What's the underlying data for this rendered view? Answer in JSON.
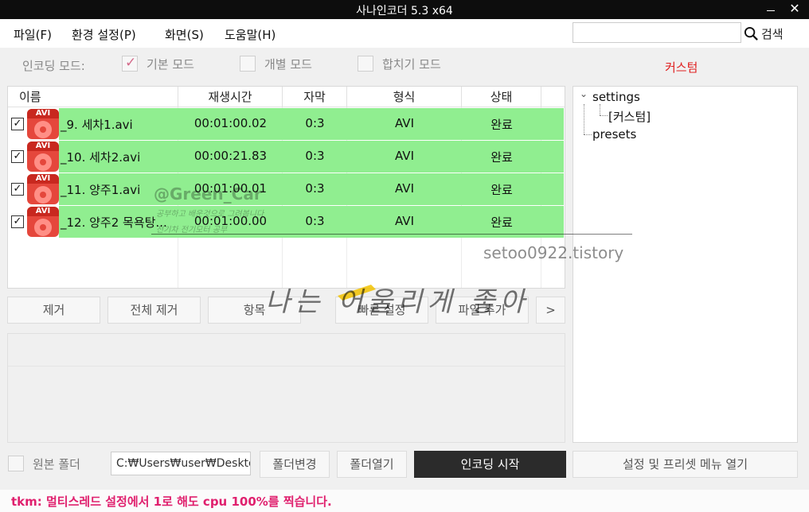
{
  "window": {
    "title": "사나인코더  5.3 x64"
  },
  "menu": {
    "items": [
      "파일(F)",
      "환경 설정(P)",
      "화면(S)",
      "도움말(H)"
    ],
    "search_label": "검색"
  },
  "mode": {
    "label": "인코딩 모드:",
    "basic": "기본 모드",
    "individual": "개별 모드",
    "merge": "합치기 모드",
    "basic_checked": true
  },
  "custom_title": "커스텀",
  "table": {
    "headers": [
      "이름",
      "재생시간",
      "자막",
      "형식",
      "상태"
    ],
    "rows": [
      {
        "name": "_9. 세차1.avi",
        "duration": "00:01:00.02",
        "subtitle": "0:3",
        "format": "AVI",
        "status": "완료"
      },
      {
        "name": "_10. 세차2.avi",
        "duration": "00:00:21.83",
        "subtitle": "0:3",
        "format": "AVI",
        "status": "완료"
      },
      {
        "name": "_11. 양주1.avi",
        "duration": "00:01:00.01",
        "subtitle": "0:3",
        "format": "AVI",
        "status": "완료"
      },
      {
        "name": "_12. 양주2 목욕탕...",
        "duration": "00:01:00.00",
        "subtitle": "0:3",
        "format": "AVI",
        "status": "완료"
      }
    ],
    "file_icon_label": "AVI"
  },
  "buttons": {
    "remove": "제거",
    "remove_all": "전체 제거",
    "item": "항목",
    "quick_settings": "빠른 설정",
    "file_add": "파일 추가",
    "more": ">",
    "folder_change": "폴더변경",
    "folder_open": "폴더열기",
    "start_encoding": "인코딩 시작",
    "open_settings_menu": "설정 및 프리셋 메뉴 열기"
  },
  "tree": {
    "root": "settings",
    "child": "[커스텀]",
    "presets": "presets"
  },
  "output": {
    "source_folder_label": "원본 폴더",
    "path": "C:₩Users₩user₩Deskto"
  },
  "status": "tkm: 멀티스레드 설정에서 1로  해도 cpu 100%를 찍습니다.",
  "watermark": {
    "green_car": "@Green_Car",
    "small1": "공부하고 배운것으로 그려봅니다",
    "small2": "전기차 전기모터 공부",
    "site": "setoo0922.tistory",
    "hand": "나는 어울리게 좋아"
  }
}
